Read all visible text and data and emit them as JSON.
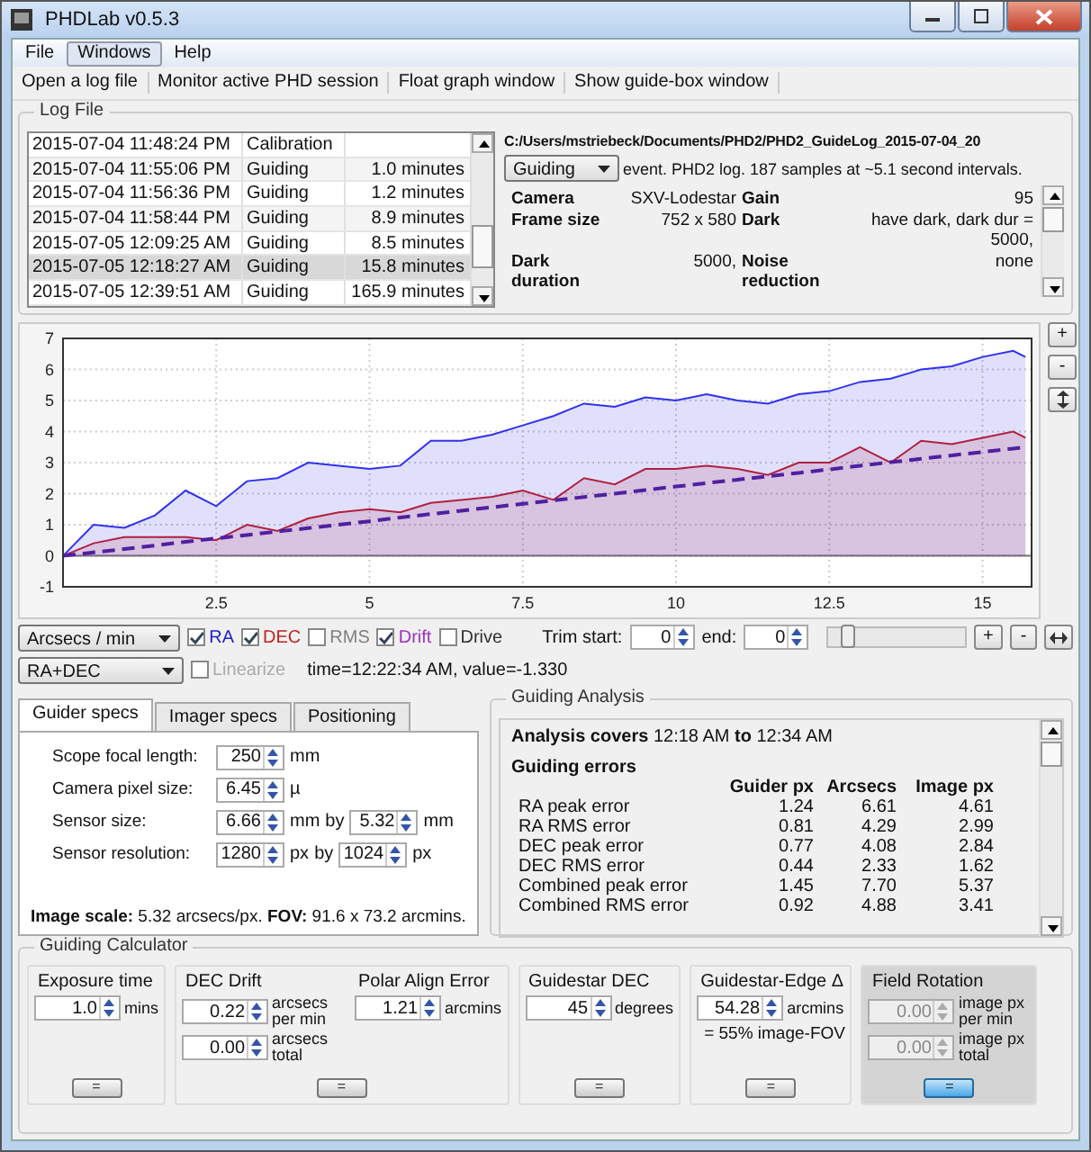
{
  "window": {
    "title": "PHDLab v0.5.3"
  },
  "menu": [
    {
      "label": "File",
      "selected": false
    },
    {
      "label": "Windows",
      "selected": true
    },
    {
      "label": "Help",
      "selected": false
    }
  ],
  "toolbar": [
    "Open a log file",
    "Monitor active PHD session",
    "Float graph window",
    "Show guide-box window"
  ],
  "log_file": {
    "title": "Log File",
    "sessions": [
      {
        "time": "2015-07-04 11:48:24 PM",
        "type": "Calibration",
        "selected": false
      },
      {
        "time": "2015-07-04 11:55:06 PM",
        "type": "Guiding",
        "duration": "1.0 minutes",
        "selected": false
      },
      {
        "time": "2015-07-04 11:56:36 PM",
        "type": "Guiding",
        "duration": "1.2 minutes",
        "selected": false
      },
      {
        "time": "2015-07-04 11:58:44 PM",
        "type": "Guiding",
        "duration": "8.9 minutes",
        "selected": false
      },
      {
        "time": "2015-07-05 12:09:25 AM",
        "type": "Guiding",
        "duration": "8.5 minutes",
        "selected": false
      },
      {
        "time": "2015-07-05 12:18:27 AM",
        "type": "Guiding",
        "duration": "15.8 minutes",
        "selected": true
      },
      {
        "time": "2015-07-05 12:39:51 AM",
        "type": "Guiding",
        "duration": "165.9 minutes",
        "selected": false
      }
    ],
    "path": "C:/Users/mstriebeck/Documents/PHD2/PHD2_GuideLog_2015-07-04_20",
    "filter": "Guiding",
    "summary": "event. PHD2 log. 187 samples at ~5.1 second intervals.",
    "properties": [
      {
        "label": "Camera",
        "value": "SXV-Lodestar"
      },
      {
        "label": "Gain",
        "value": "95"
      },
      {
        "label": "Frame size",
        "value": "752 x 580"
      },
      {
        "label": "Dark",
        "value": "have dark, dark dur = 5000,"
      },
      {
        "label": "Dark duration",
        "value": "5000,"
      },
      {
        "label": "Noise reduction",
        "value": "none"
      }
    ]
  },
  "graph": {
    "zoom_buttons": [
      "+",
      "-"
    ],
    "chart_data": {
      "type": "area",
      "x": [
        0,
        0.5,
        1,
        1.5,
        2,
        2.5,
        3,
        3.5,
        4,
        4.5,
        5,
        5.5,
        6,
        6.5,
        7,
        7.5,
        8,
        8.5,
        9,
        9.5,
        10,
        10.5,
        11,
        11.5,
        12,
        12.5,
        13,
        13.5,
        14,
        14.5,
        15,
        15.5,
        15.7
      ],
      "grid": true,
      "xlim": [
        0,
        15.8
      ],
      "ylim": [
        -1,
        7
      ],
      "xticks": [
        2.5,
        5,
        7.5,
        10,
        12.5,
        15
      ],
      "yticks": [
        -1,
        0,
        1,
        2,
        3,
        4,
        5,
        6,
        7
      ],
      "series": [
        {
          "name": "RA",
          "color": "#3030f0",
          "values": [
            0,
            1.0,
            0.9,
            1.3,
            2.1,
            1.6,
            2.4,
            2.5,
            3.0,
            2.9,
            2.8,
            2.9,
            3.7,
            3.7,
            3.9,
            4.2,
            4.5,
            4.9,
            4.8,
            5.1,
            5.0,
            5.2,
            5.0,
            4.9,
            5.2,
            5.3,
            5.6,
            5.7,
            6.0,
            6.1,
            6.4,
            6.6,
            6.4
          ]
        },
        {
          "name": "DEC",
          "color": "#b02040",
          "values": [
            0,
            0.4,
            0.6,
            0.6,
            0.6,
            0.5,
            1.0,
            0.8,
            1.2,
            1.4,
            1.5,
            1.4,
            1.7,
            1.8,
            1.9,
            2.1,
            1.8,
            2.5,
            2.3,
            2.8,
            2.8,
            2.9,
            2.8,
            2.6,
            3.0,
            3.0,
            3.5,
            3.0,
            3.7,
            3.6,
            3.8,
            4.0,
            3.8
          ]
        },
        {
          "name": "Drift",
          "color": "#5020a0",
          "type": "line",
          "line_style": "dashed",
          "values": [
            0,
            0.11,
            0.22,
            0.33,
            0.45,
            0.56,
            0.67,
            0.78,
            0.89,
            1.0,
            1.11,
            1.23,
            1.34,
            1.45,
            1.56,
            1.67,
            1.78,
            1.89,
            2.0,
            2.12,
            2.23,
            2.34,
            2.45,
            2.56,
            2.67,
            2.78,
            2.9,
            3.01,
            3.12,
            3.23,
            3.34,
            3.45,
            3.5
          ]
        }
      ]
    }
  },
  "controls": {
    "units": "Arcsecs / min",
    "axis": "RA+DEC",
    "toggles": [
      {
        "kind": "series",
        "checked": true,
        "color": "#2020d0"
      },
      {
        "kind": "series",
        "checked": true,
        "color": "#c02020"
      },
      {
        "kind": "option",
        "label": "RMS",
        "checked": false,
        "color": "#808080"
      },
      {
        "kind": "series",
        "checked": true,
        "color": "#a030c0"
      },
      {
        "kind": "option",
        "label": "Drive",
        "checked": false,
        "color": "#303030"
      }
    ],
    "linearize": {
      "label": "Linearize",
      "checked": false,
      "disabled": true
    },
    "trim_start_label": "Trim start:",
    "trim_start": "0",
    "trim_end_label": "end:",
    "trim_end": "0",
    "trim_slider": {
      "level": 0.1
    },
    "zoom_buttons": [
      "+",
      "-"
    ],
    "readout": "time=12:22:34 AM, value=-1.330"
  },
  "specs": {
    "tabs": [
      {
        "label": "Guider specs",
        "selected": true
      },
      {
        "label": "Imager specs",
        "selected": false
      },
      {
        "label": "Positioning",
        "selected": false
      }
    ],
    "fields": [
      {
        "label": "Scope focal length:",
        "values": [
          {
            "value": "250",
            "unit": "mm"
          }
        ]
      },
      {
        "label": "Camera pixel size:",
        "values": [
          {
            "value": "6.45",
            "unit": "µ"
          }
        ]
      },
      {
        "label": "Sensor size:",
        "joiner": "by",
        "values": [
          {
            "value": "6.66",
            "unit": "mm"
          },
          {
            "value": "5.32",
            "unit": "mm"
          }
        ]
      },
      {
        "label": "Sensor resolution:",
        "joiner": "by",
        "values": [
          {
            "value": "1280",
            "unit": "px"
          },
          {
            "value": "1024",
            "unit": "px"
          }
        ]
      }
    ],
    "summary": "**Image scale:** 5.32 arcsecs/px. **FOV:** 91.6 x 73.2 arcmins."
  },
  "analysis": {
    "title": "Guiding Analysis",
    "covers": "**Analysis covers** 12:18 AM **to** 12:34 AM",
    "errors_title": "Guiding errors",
    "columns": [
      "Guider px",
      "Arcsecs",
      "Image px"
    ],
    "rows": [
      {
        "label": "RA peak error",
        "values": [
          "1.24",
          "6.61",
          "4.61"
        ]
      },
      {
        "label": "RA RMS error",
        "values": [
          "0.81",
          "4.29",
          "2.99"
        ]
      },
      {
        "label": "DEC peak error",
        "values": [
          "0.77",
          "4.08",
          "2.84"
        ]
      },
      {
        "label": "DEC RMS error",
        "values": [
          "0.44",
          "2.33",
          "1.62"
        ]
      },
      {
        "label": "Combined peak error",
        "values": [
          "1.45",
          "7.70",
          "5.37"
        ]
      },
      {
        "label": "Combined RMS error",
        "values": [
          "0.92",
          "4.88",
          "3.41"
        ]
      }
    ]
  },
  "calculator": {
    "title": "Guiding Calculator",
    "sections": [
      {
        "disabled": false,
        "button": {
          "label": "=",
          "default": false
        },
        "columns": [
          {
            "title": "Exposure time",
            "fields": [
              {
                "value": "1.0",
                "unit": "mins"
              }
            ]
          }
        ]
      },
      {
        "disabled": false,
        "button": {
          "label": "=",
          "default": false
        },
        "columns": [
          {
            "title": "DEC Drift",
            "fields": [
              {
                "value": "0.22",
                "unit": "arcsecs per min"
              },
              {
                "value": "0.00",
                "unit": "arcsecs total"
              }
            ]
          },
          {
            "title": "Polar Align Error",
            "fields": [
              {
                "value": "1.21",
                "unit": "arcmins"
              }
            ]
          }
        ]
      },
      {
        "disabled": false,
        "button": {
          "label": "=",
          "default": false
        },
        "columns": [
          {
            "title": "Guidestar DEC",
            "fields": [
              {
                "value": "45",
                "unit": "degrees"
              }
            ]
          }
        ]
      },
      {
        "disabled": false,
        "button": {
          "label": "=",
          "default": false
        },
        "note": "= 55% image-FOV",
        "columns": [
          {
            "title": "Guidestar-Edge Δ",
            "fields": [
              {
                "value": "54.28",
                "unit": "arcmins"
              }
            ]
          }
        ]
      },
      {
        "disabled": true,
        "button": {
          "label": "=",
          "default": true
        },
        "columns": [
          {
            "title": "Field Rotation",
            "fields": [
              {
                "value": "0.00",
                "unit": "image px per min"
              },
              {
                "value": "0.00",
                "unit": "image px total"
              }
            ]
          }
        ]
      }
    ]
  }
}
